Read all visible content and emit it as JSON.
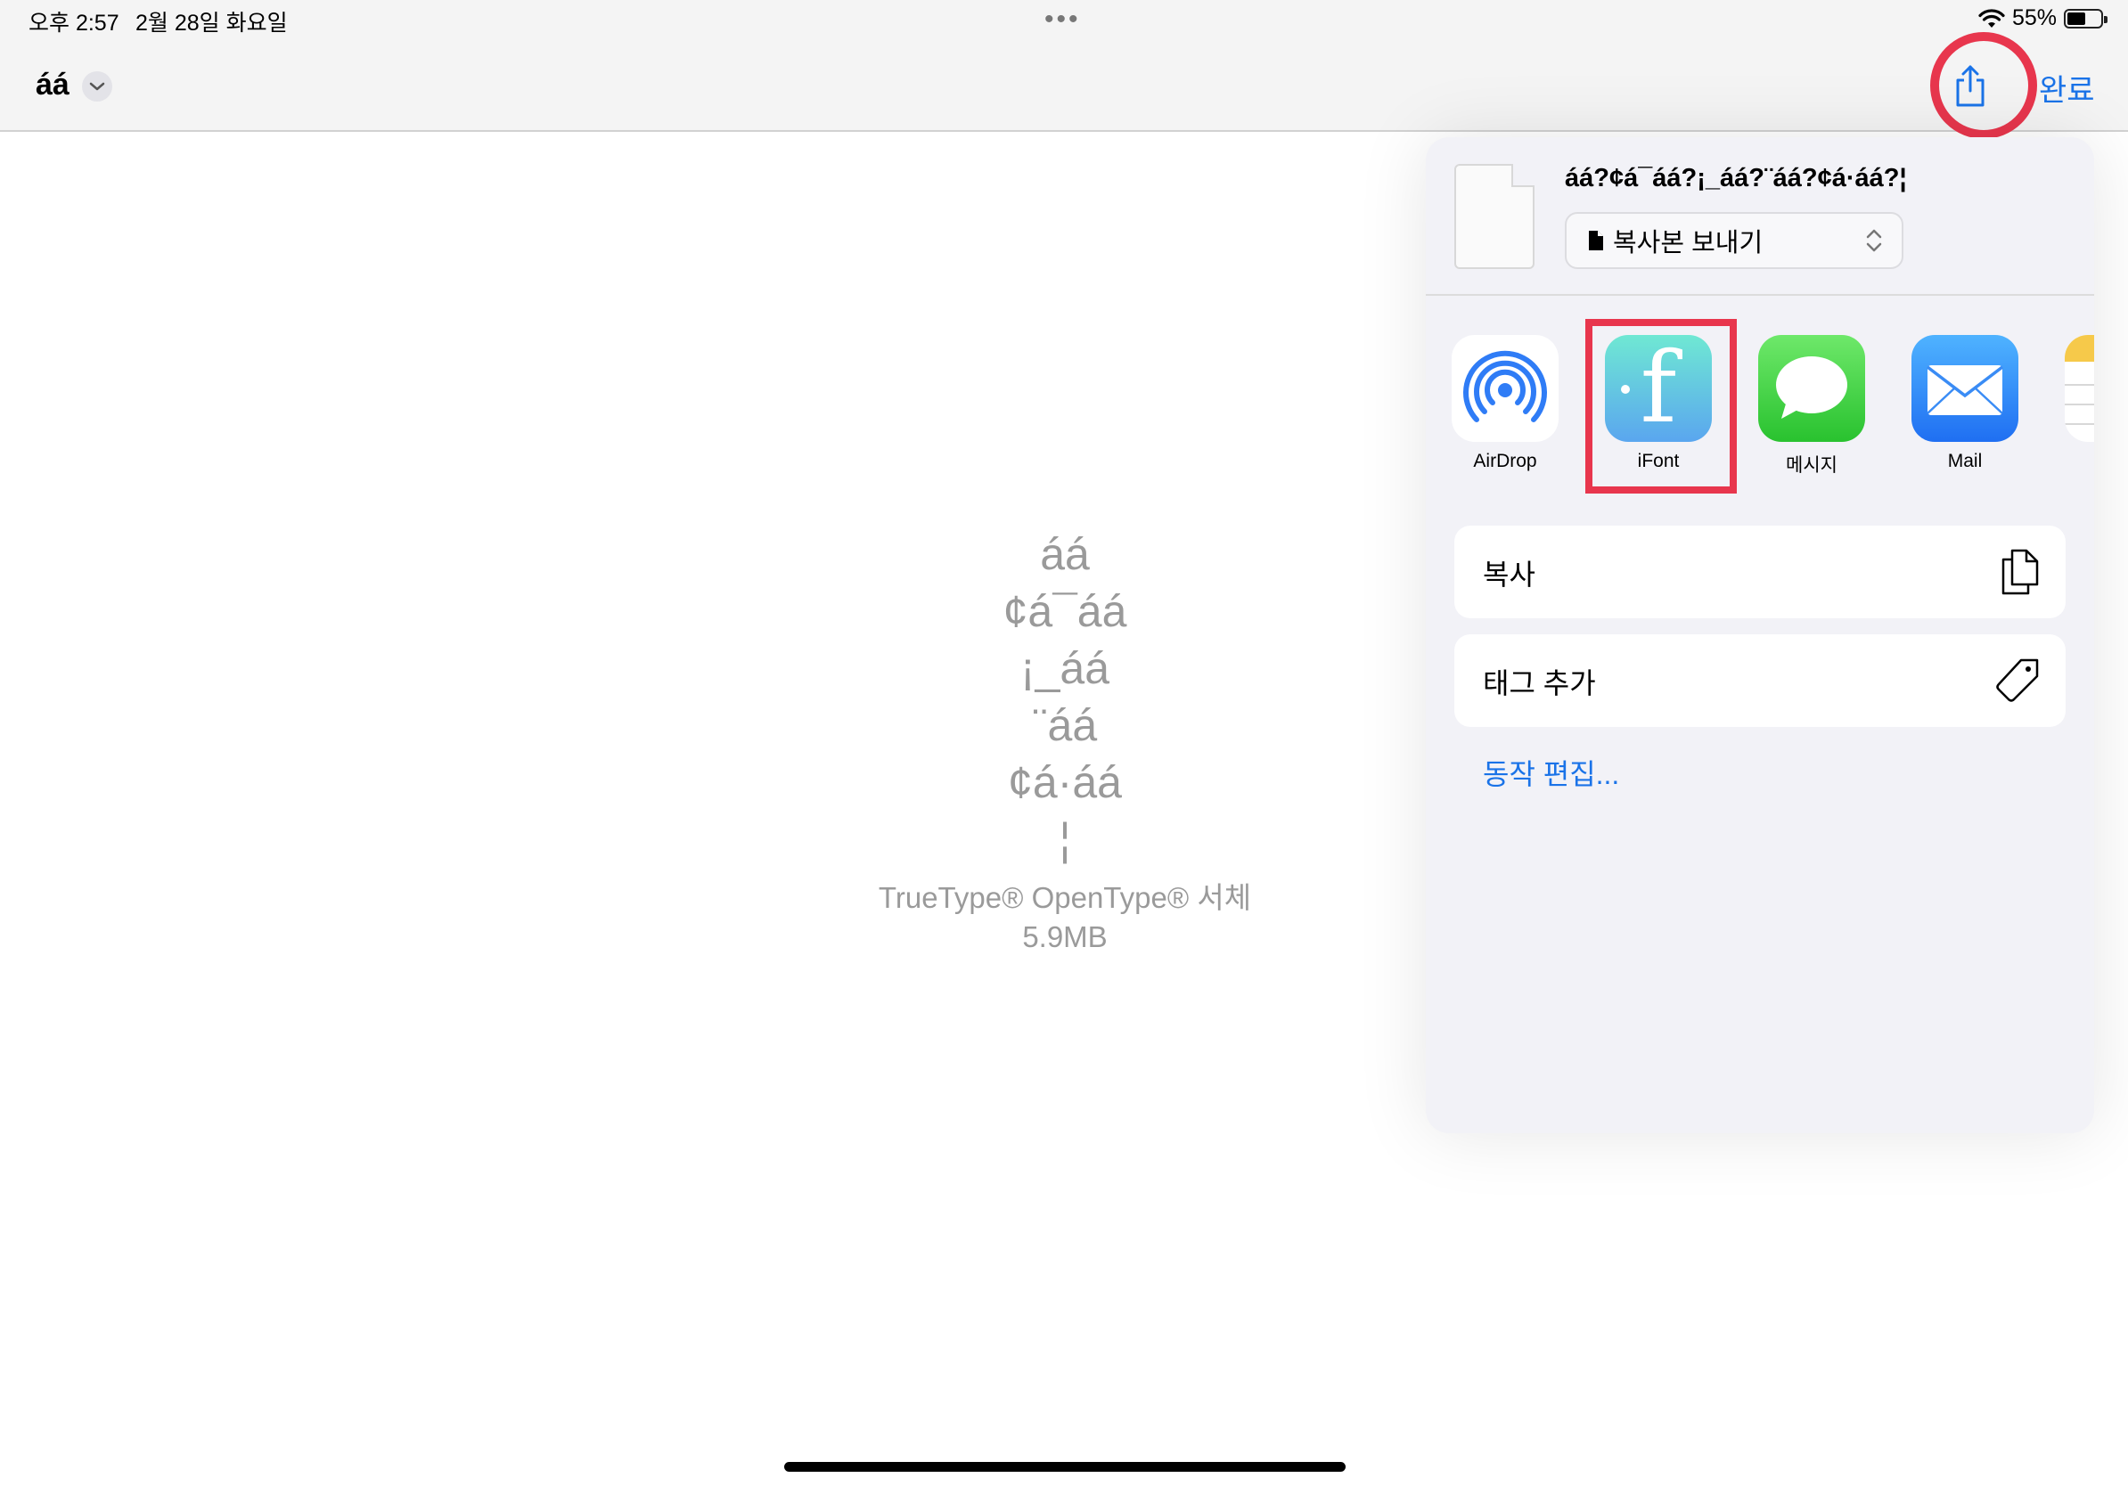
{
  "status_bar": {
    "time": "오후 2:57",
    "date": "2월 28일 화요일",
    "dots": "•••",
    "battery_percent": "55%",
    "battery_level": 0.55
  },
  "nav": {
    "title": "áá",
    "done_label": "완료"
  },
  "preview": {
    "glyph_lines": [
      "áá",
      "¢á¯áá",
      "¡_áá",
      "¨áá",
      "¢á·áá",
      "¦"
    ],
    "font_type": "TrueType® OpenType® 서체",
    "file_size": "5.9MB"
  },
  "share_sheet": {
    "filename": "áá?¢á¯áá?¡_áá?¨áá?¢á·áá?¦",
    "send_copy_label": "복사본 보내기",
    "apps": [
      {
        "label": "AirDrop",
        "icon": "airdrop-icon"
      },
      {
        "label": "iFont",
        "icon": "ifont-icon"
      },
      {
        "label": "메시지",
        "icon": "messages-icon"
      },
      {
        "label": "Mail",
        "icon": "mail-icon"
      },
      {
        "label": "",
        "icon": "notes-icon"
      }
    ],
    "actions": [
      {
        "label": "복사",
        "icon": "copy-icon"
      },
      {
        "label": "태그 추가",
        "icon": "tag-icon"
      }
    ],
    "edit_actions_label": "동작 편집..."
  },
  "colors": {
    "accent": "#1a73e8",
    "highlight": "#e8364d"
  }
}
